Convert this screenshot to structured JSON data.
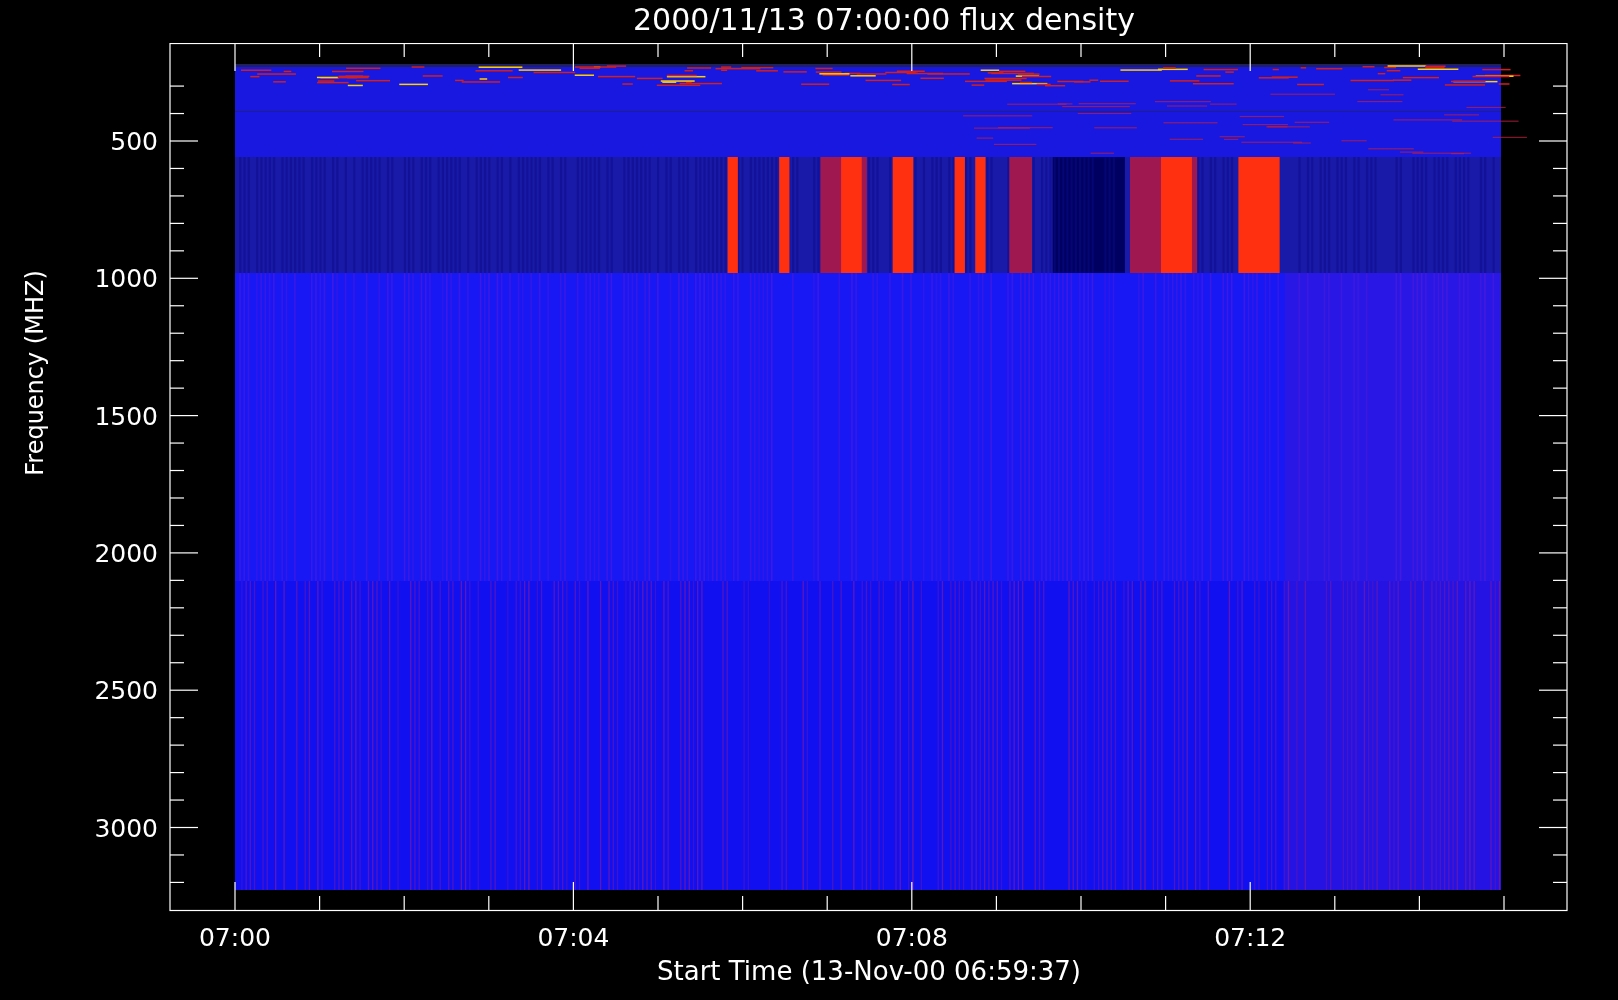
{
  "title": "2000/11/13 07:00:00 flux density",
  "y_axis": {
    "label": "Frequency (MHZ)",
    "tick_labels": [
      "500",
      "1000",
      "1500",
      "2000",
      "2500",
      "3000"
    ]
  },
  "x_axis": {
    "label": "Start Time (13-Nov-00 06:59:37)",
    "tick_labels": [
      "07:00",
      "07:04",
      "07:08",
      "07:12"
    ]
  }
}
